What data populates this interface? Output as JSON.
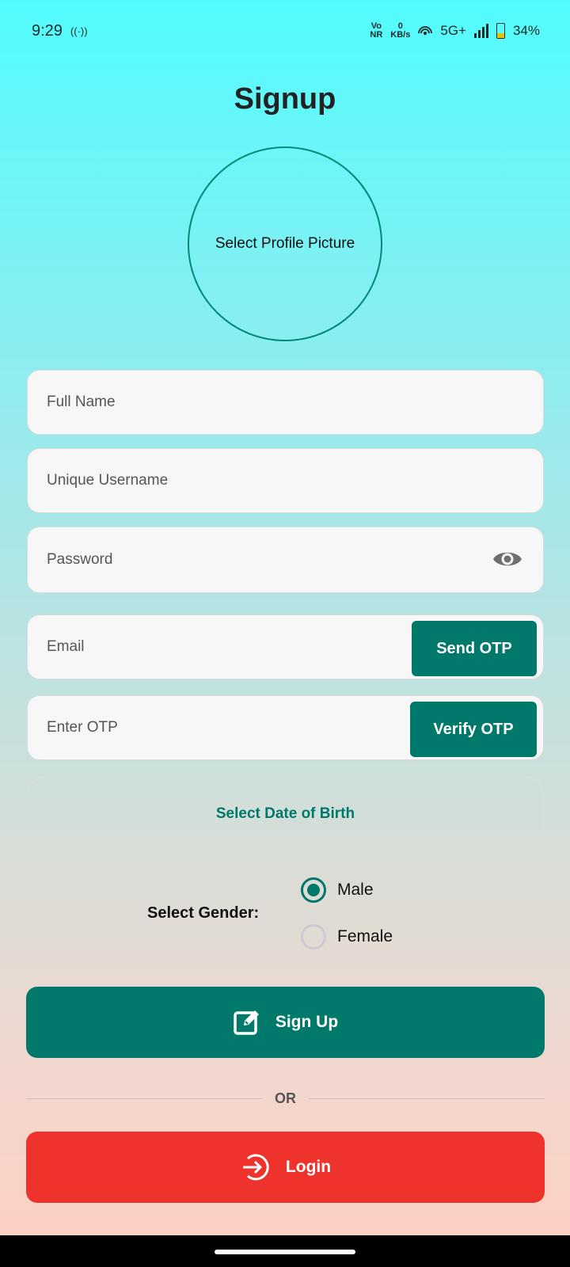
{
  "status_bar": {
    "time": "9:29",
    "hotspot_icon_label": "((·))",
    "vo_nr": "Vo\nNR",
    "speed_value": "0",
    "speed_unit": "KB/s",
    "network": "5G+",
    "battery": "34%",
    "battery_level": 0.34
  },
  "page": {
    "title": "Signup",
    "profile_picture": "Select Profile Picture"
  },
  "form": {
    "full_name_placeholder": "Full Name",
    "username_placeholder": "Unique Username",
    "password_placeholder": "Password",
    "email_placeholder": "Email",
    "send_otp_label": "Send OTP",
    "otp_placeholder": "Enter OTP",
    "verify_otp_label": "Verify OTP",
    "dob_label": "Select Date of Birth",
    "gender_label": "Select Gender:",
    "gender_options": [
      {
        "label": "Male",
        "selected": true
      },
      {
        "label": "Female",
        "selected": false
      }
    ]
  },
  "actions": {
    "signup_label": "Sign Up",
    "or_label": "OR",
    "login_label": "Login"
  },
  "colors": {
    "primary": "#00796b",
    "danger": "#ee332c"
  },
  "icons": {
    "eye": "eye-icon",
    "signup": "edit-icon",
    "login": "login-icon"
  }
}
